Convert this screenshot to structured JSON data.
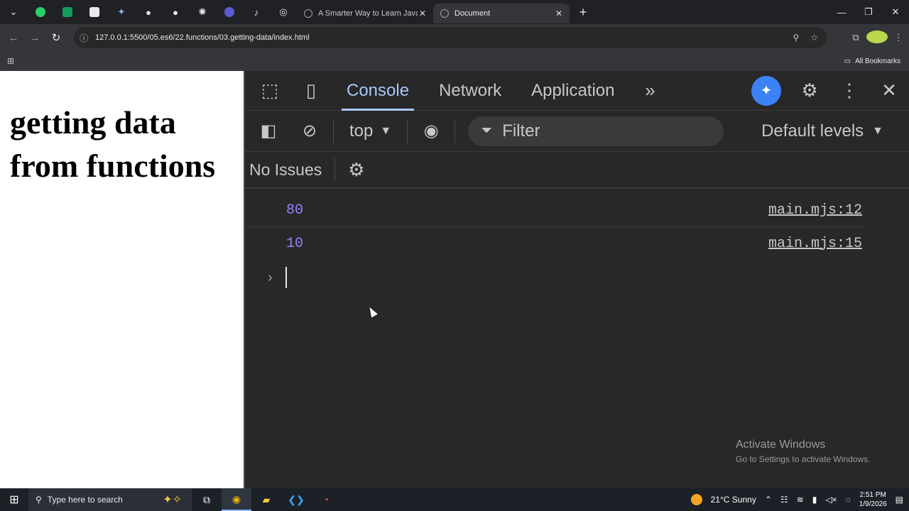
{
  "browser": {
    "tabs": [
      {
        "title": "A Smarter Way to Learn JavaSc",
        "active": false
      },
      {
        "title": "Document",
        "active": true
      }
    ],
    "pinned_icons": [
      "whatsapp-icon",
      "sheets-icon",
      "app-icon",
      "gemini-icon",
      "github-icon",
      "github-icon",
      "chatgpt-icon",
      "app-icon",
      "tiktok-icon",
      "chrome-icon"
    ],
    "url": "127.0.0.1:5500/05.es6/22.functions/03.getting-data/index.html",
    "all_bookmarks": "All Bookmarks"
  },
  "page": {
    "heading": "getting data from functions"
  },
  "devtools": {
    "tabs": [
      "Console",
      "Network",
      "Application"
    ],
    "active_tab": "Console",
    "context": "top",
    "filter_placeholder": "Filter",
    "levels": "Default levels",
    "issues": "No Issues",
    "logs": [
      {
        "value": "80",
        "source": "main.mjs:12"
      },
      {
        "value": "10",
        "source": "main.mjs:15"
      }
    ],
    "accent": "#a8c7fa",
    "number_color": "#9980ff"
  },
  "watermark": {
    "line1": "Activate Windows",
    "line2": "Go to Settings to activate Windows."
  },
  "taskbar": {
    "search_placeholder": "Type here to search",
    "weather": "21°C  Sunny",
    "time": "2:51 PM",
    "date": "1/9/2026"
  }
}
